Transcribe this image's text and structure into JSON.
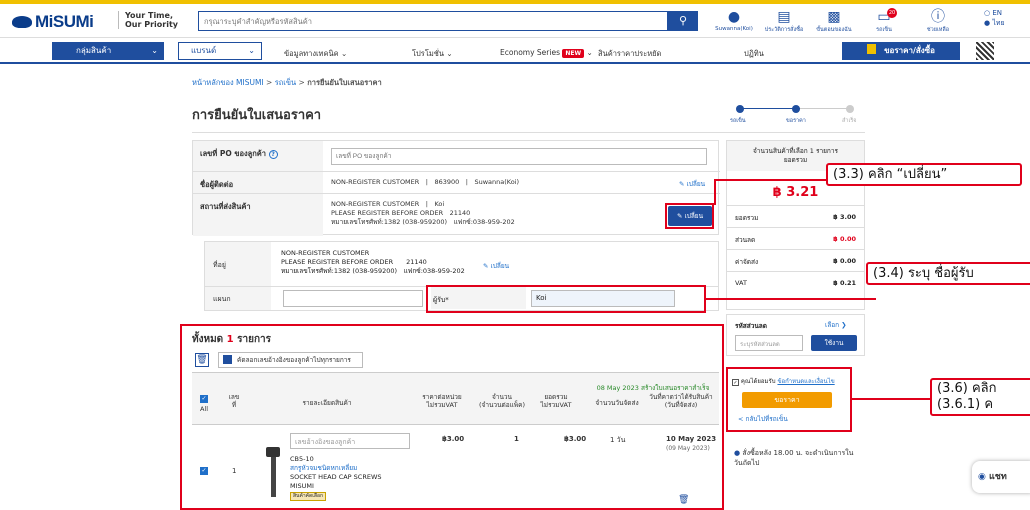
{
  "header": {
    "logo": "MiSUMi",
    "tagline1": "Your Time,",
    "tagline2": "Our Priority",
    "search_placeholder": "กรุณาระบุคำสำคัญหรือรหัสสินค้า",
    "icons": [
      {
        "name": "account",
        "label": "Suwanna(Koi)"
      },
      {
        "name": "history",
        "label": "ประวัติการสั่งซื้อ"
      },
      {
        "name": "folder",
        "label": "ขั้นตอนของฉัน"
      },
      {
        "name": "cart",
        "label": "รถเข็น",
        "badge": "20"
      },
      {
        "name": "help",
        "label": "ช่วยเหลือ"
      }
    ],
    "lang_en": "EN",
    "lang_th": "ไทย"
  },
  "nav": {
    "category": "กลุ่มสินค้า",
    "brand": "แบรนด์",
    "tech": "ข้อมูลทางเทคนิค",
    "promo": "โปรโมชั่น",
    "economy": "Economy Series",
    "new_badge": "NEW",
    "price_items": "สินค้าราคาประหยัด",
    "calendar": "ปฏิทิน",
    "order": "ขอราคา/สั่งซื้อ"
  },
  "breadcrumb": {
    "home": "หน้าหลักของ MISUMI",
    "sep": " > ",
    "cart": "รถเข็น",
    "current": "การยืนยันใบเสนอราคา"
  },
  "page_title": "การยืนยันใบเสนอราคา",
  "steps": [
    "รถเข็น",
    "ขอราคา",
    "สำเร็จ"
  ],
  "form": {
    "po_label": "เลขที่ PO ของลูกค้า",
    "po_help": "?",
    "po_placeholder": "เลขที่ PO ของลูกค้า",
    "contact_label": "ชื่อผู้ติดต่อ",
    "contact_value": "NON-REGISTER CUSTOMER　|　863900　|　Suwanna(Koi)",
    "change": "เปลี่ยน",
    "ship_label": "สถานที่ส่งสินค้า",
    "ship_line1": "NON-REGISTER CUSTOMER　|　Koi",
    "ship_line2": "PLEASE REGISTER BEFORE ORDER　21140",
    "ship_line3": "หมายเลขโทรศัพท์:1382 (038-959200)　แฟกซ์:038-959-202",
    "addr_label": "ที่อยู่",
    "addr_line1": "NON-REGISTER CUSTOMER",
    "addr_line2": "PLEASE REGISTER BEFORE ORDER　　21140",
    "addr_line3": "หมายเลขโทรศัพท์:1382 (038-959200)　แฟกซ์:038-959-202",
    "dept_label": "แผนก",
    "recv_label": "ผู้รับ*",
    "recv_value": "Koi"
  },
  "list": {
    "title_prefix": "ทั้งหมด",
    "count": "1",
    "title_suffix": "รายการ",
    "copy_btn": "คัดลอกเลขอ้างอิงของลูกค้าไปทุกรายการ",
    "h_all": "All",
    "h_no": "เลขที่",
    "h_detail": "รายละเอียดสินค้า",
    "h_unit": "ราคาต่อหน่วย\nไม่รวมVAT",
    "h_qty": "จำนวน\n(จำนวนต่อแพ็ค)",
    "h_total": "ยอดรวม\nไม่รวมVAT",
    "h_days": "จำนวนวันจัดส่ง",
    "h_date_note": "08 May 2023 สร้างใบเสนอราคาสำเร็จ",
    "h_date": "วันที่คาดว่าได้รับสินค้า\n(วันที่จัดส่ง)",
    "row": {
      "no": "1",
      "ref_placeholder": "เลขอ้างอิงของลูกค้า",
      "code": "CB5-10",
      "type": "สกรูหัวจมชนิดหกเหลี่ยม",
      "name1": "SOCKET HEAD CAP SCREWS",
      "brand": "MISUMI",
      "tag": "สินค้าคัดเลือก",
      "unit": "฿3.00",
      "qty": "1",
      "total": "฿3.00",
      "days": "1 วัน",
      "date": "10 May 2023",
      "ship_date": "(09 May 2023)"
    }
  },
  "summary": {
    "top": "จำนวนสินค้าที่เลือก 1 รายการ",
    "top2": "ยอดรวม",
    "price": "฿ 3.21",
    "rows": [
      {
        "label": "ยอดรวม",
        "value": "฿ 3.00",
        "red": false
      },
      {
        "label": "ส่วนลด",
        "value": "฿ 0.00",
        "red": true
      },
      {
        "label": "ค่าจัดส่ง",
        "value": "฿ 0.00",
        "red": false
      },
      {
        "label": "VAT",
        "value": "฿ 0.21",
        "red": false
      }
    ],
    "coupon_label": "รหัสส่วนลด",
    "coupon_select": "เลือก",
    "coupon_placeholder": "ระบุรหัสส่วนลด",
    "coupon_apply": "ใช้งาน",
    "agree_text": "คุณได้ยอมรับ",
    "agree_link": "ข้อกำหนดและเงื่อนไข",
    "quote_btn": "ขอราคา",
    "back_link": "< กลับไปที่รถเข็น",
    "note": "สั่งซื้อหลัง 18.00 น. จะดำเนินการในวันถัดไป"
  },
  "callouts": {
    "c33": "(3.3) คลิก “เปลี่ยน”",
    "c34": "(3.4) ระบุ ชื่อผู้รับ",
    "c36a": "(3.6) คลิก",
    "c36b": "(3.6.1) ค"
  },
  "chat": "แชท"
}
